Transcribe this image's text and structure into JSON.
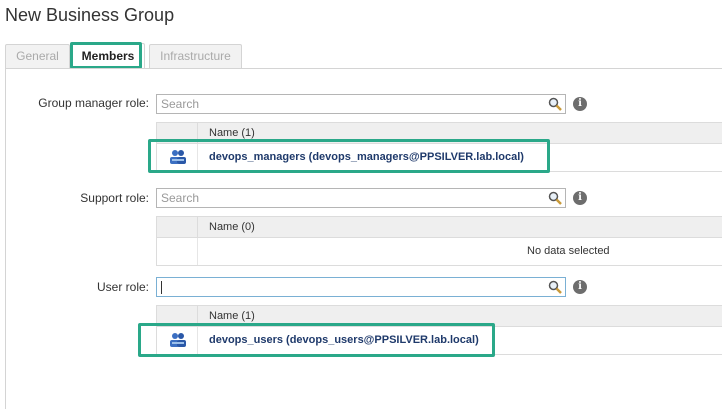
{
  "page": {
    "title": "New Business Group"
  },
  "tabs": [
    {
      "label": "General",
      "active": false,
      "enabled": true
    },
    {
      "label": "Members",
      "active": true,
      "enabled": true
    },
    {
      "label": "Infrastructure",
      "active": false,
      "enabled": false
    }
  ],
  "roles": {
    "group_manager": {
      "label": "Group manager role:",
      "search_placeholder": "Search",
      "search_value": "",
      "column_header": "Name (1)",
      "members": [
        "devops_managers (devops_managers@PPSILVER.lab.local)"
      ]
    },
    "support": {
      "label": "Support role:",
      "search_placeholder": "Search",
      "search_value": "",
      "column_header": "Name (0)",
      "empty_message": "No data selected"
    },
    "user": {
      "label": "User role:",
      "search_placeholder": "",
      "search_value": "",
      "column_header": "Name (1)",
      "members": [
        "devops_users (devops_users@PPSILVER.lab.local)"
      ]
    }
  },
  "icons": {
    "search": "magnifier-icon",
    "info": "info-icon",
    "group": "user-group-icon"
  },
  "colors": {
    "highlight": "#2aa889",
    "member_text": "#1f3a6b"
  }
}
